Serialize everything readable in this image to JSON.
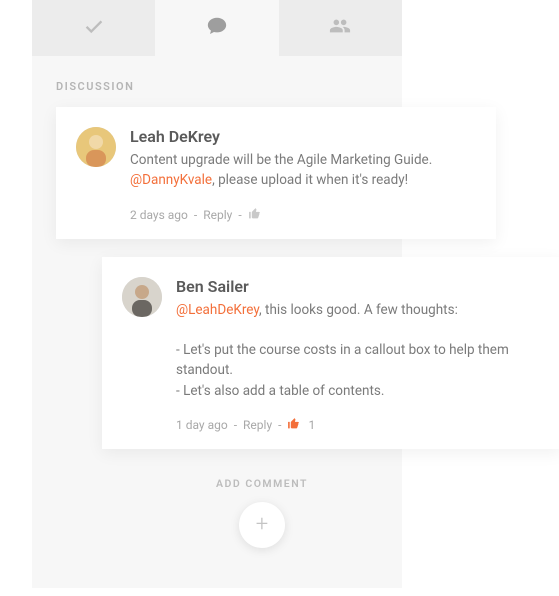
{
  "section_label": "DISCUSSION",
  "tabs": [
    {
      "icon": "check"
    },
    {
      "icon": "comment"
    },
    {
      "icon": "people"
    }
  ],
  "comments": [
    {
      "author": "Leah DeKrey",
      "pre_text": "Content upgrade will be the Agile Marketing Guide. ",
      "mention": "@DannyKvale",
      "post_text": ", please upload it when it's ready!",
      "time": "2 days ago",
      "reply_label": "Reply",
      "liked": false,
      "like_count": ""
    },
    {
      "author": "Ben Sailer",
      "pre_text": "",
      "mention": "@LeahDeKrey",
      "post_text": ", this looks good. A few thoughts:\n\n- Let's put the course costs in a callout box to help them standout.\n- Let's also add a table of contents.",
      "time": "1 day ago",
      "reply_label": "Reply",
      "liked": true,
      "like_count": "1"
    }
  ],
  "add_comment_label": "ADD COMMENT"
}
